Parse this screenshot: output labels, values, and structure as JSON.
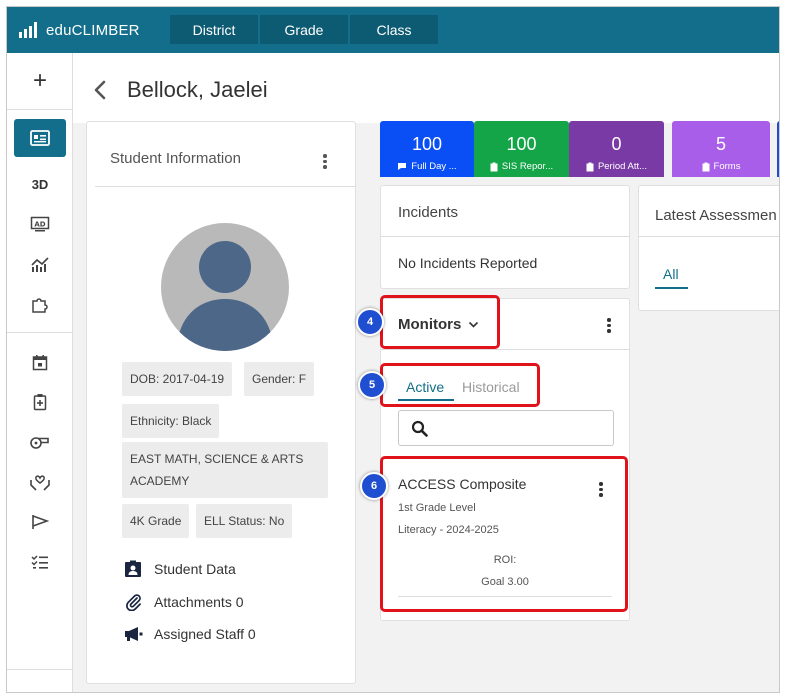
{
  "app": {
    "name": "eduCLIMBER"
  },
  "nav": {
    "tabs": [
      "District",
      "Grade",
      "Class"
    ]
  },
  "header": {
    "title": "Bellock, Jaelei"
  },
  "student_info": {
    "title": "Student Information",
    "chips": {
      "dob": "DOB: 2017-04-19",
      "gender": "Gender: F",
      "ethnicity": "Ethnicity: Black",
      "school_line1": "EAST MATH, SCIENCE & ARTS",
      "school_line2": "ACADEMY",
      "grade": "4K Grade",
      "ell": "ELL Status: No"
    },
    "links": {
      "student_data": "Student Data",
      "attachments": "Attachments 0",
      "assigned_staff": "Assigned Staff 0"
    }
  },
  "tiles": [
    {
      "value": "100",
      "label": "Full Day ...",
      "color": "#0a4ff5"
    },
    {
      "value": "100",
      "label": "SIS Repor...",
      "color": "#14a548"
    },
    {
      "value": "0",
      "label": "Period Att...",
      "color": "#7a3aa5"
    },
    {
      "value": "5",
      "label": "Forms",
      "color": "#a85ee8"
    }
  ],
  "incidents": {
    "title": "Incidents",
    "empty_text": "No Incidents Reported"
  },
  "latest_assessments": {
    "title": "Latest Assessmen",
    "tab": "All"
  },
  "monitors": {
    "title": "Monitors",
    "tabs": {
      "active": "Active",
      "historical": "Historical"
    },
    "search_placeholder": "",
    "item": {
      "title": "ACCESS Composite",
      "grade_level": "1st Grade Level",
      "subject_year": "Literacy - 2024-2025",
      "roi": "ROI:",
      "goal": "Goal 3.00"
    }
  },
  "annotations": {
    "badge4": "4",
    "badge5": "5",
    "badge6": "6"
  },
  "colors": {
    "brand": "#126e8a",
    "highlight": "#e0121a",
    "badge": "#1f4fd0"
  }
}
